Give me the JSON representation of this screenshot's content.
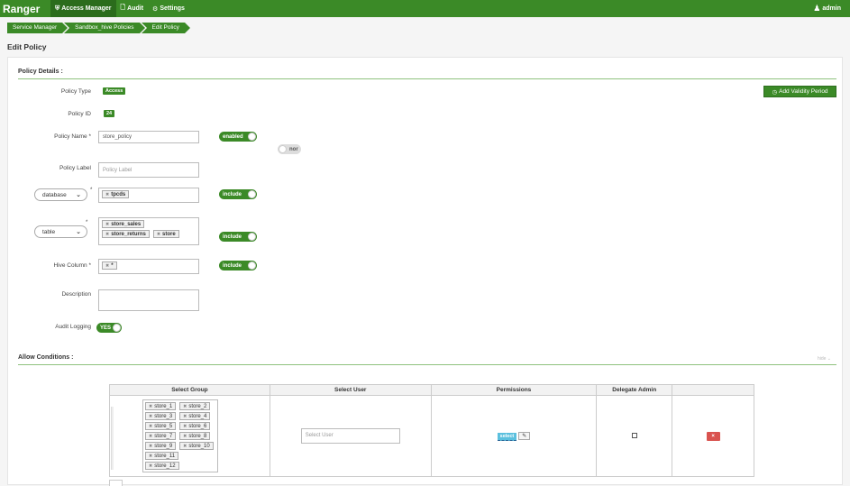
{
  "brand": "Ranger",
  "nav": [
    {
      "label": "Access Manager",
      "icon": "shield-icon"
    },
    {
      "label": "Audit",
      "icon": "file-icon"
    },
    {
      "label": "Settings",
      "icon": "gear-icon"
    }
  ],
  "user": {
    "label": "admin",
    "icon": "users-icon"
  },
  "breadcrumb": [
    "Service Manager",
    "Sandbox_hive Policies",
    "Edit Policy"
  ],
  "page_title": "Edit Policy",
  "policy_details": {
    "section_title": "Policy Details :",
    "policy_type_label": "Policy Type",
    "policy_type_value": "Access",
    "add_validity_label": "Add Validity Period",
    "policy_id_label": "Policy ID",
    "policy_id_value": "24",
    "policy_name_label": "Policy Name *",
    "policy_name_value": "store_policy",
    "enabled_toggle": "enabled",
    "normal_toggle": "nor",
    "policy_label_label": "Policy Label",
    "policy_label_placeholder": "Policy Label",
    "resource1_select": "database",
    "resource1_req": "*",
    "resource1_values": [
      "tpcds"
    ],
    "resource1_toggle": "include",
    "resource2_select": "table",
    "resource2_req": "*",
    "resource2_values": [
      "store_sales",
      "store_returns",
      "store"
    ],
    "resource2_toggle": "include",
    "column_label": "Hive Column *",
    "column_values": [
      "*"
    ],
    "column_toggle": "include",
    "description_label": "Description",
    "audit_label": "Audit Logging",
    "audit_toggle": "YES"
  },
  "allow_conditions": {
    "section_title": "Allow Conditions :",
    "hide_link": "hide ⌄",
    "headers": [
      "Select Group",
      "Select User",
      "Permissions",
      "Delegate Admin",
      ""
    ],
    "groups": [
      "store_1",
      "store_2",
      "store_3",
      "store_4",
      "store_5",
      "store_6",
      "store_7",
      "store_8",
      "store_9",
      "store_10",
      "store_11",
      "store_12"
    ],
    "user_placeholder": "Select User",
    "permission": "select",
    "edit_icon": "pencil-icon",
    "delete_label": "×"
  }
}
